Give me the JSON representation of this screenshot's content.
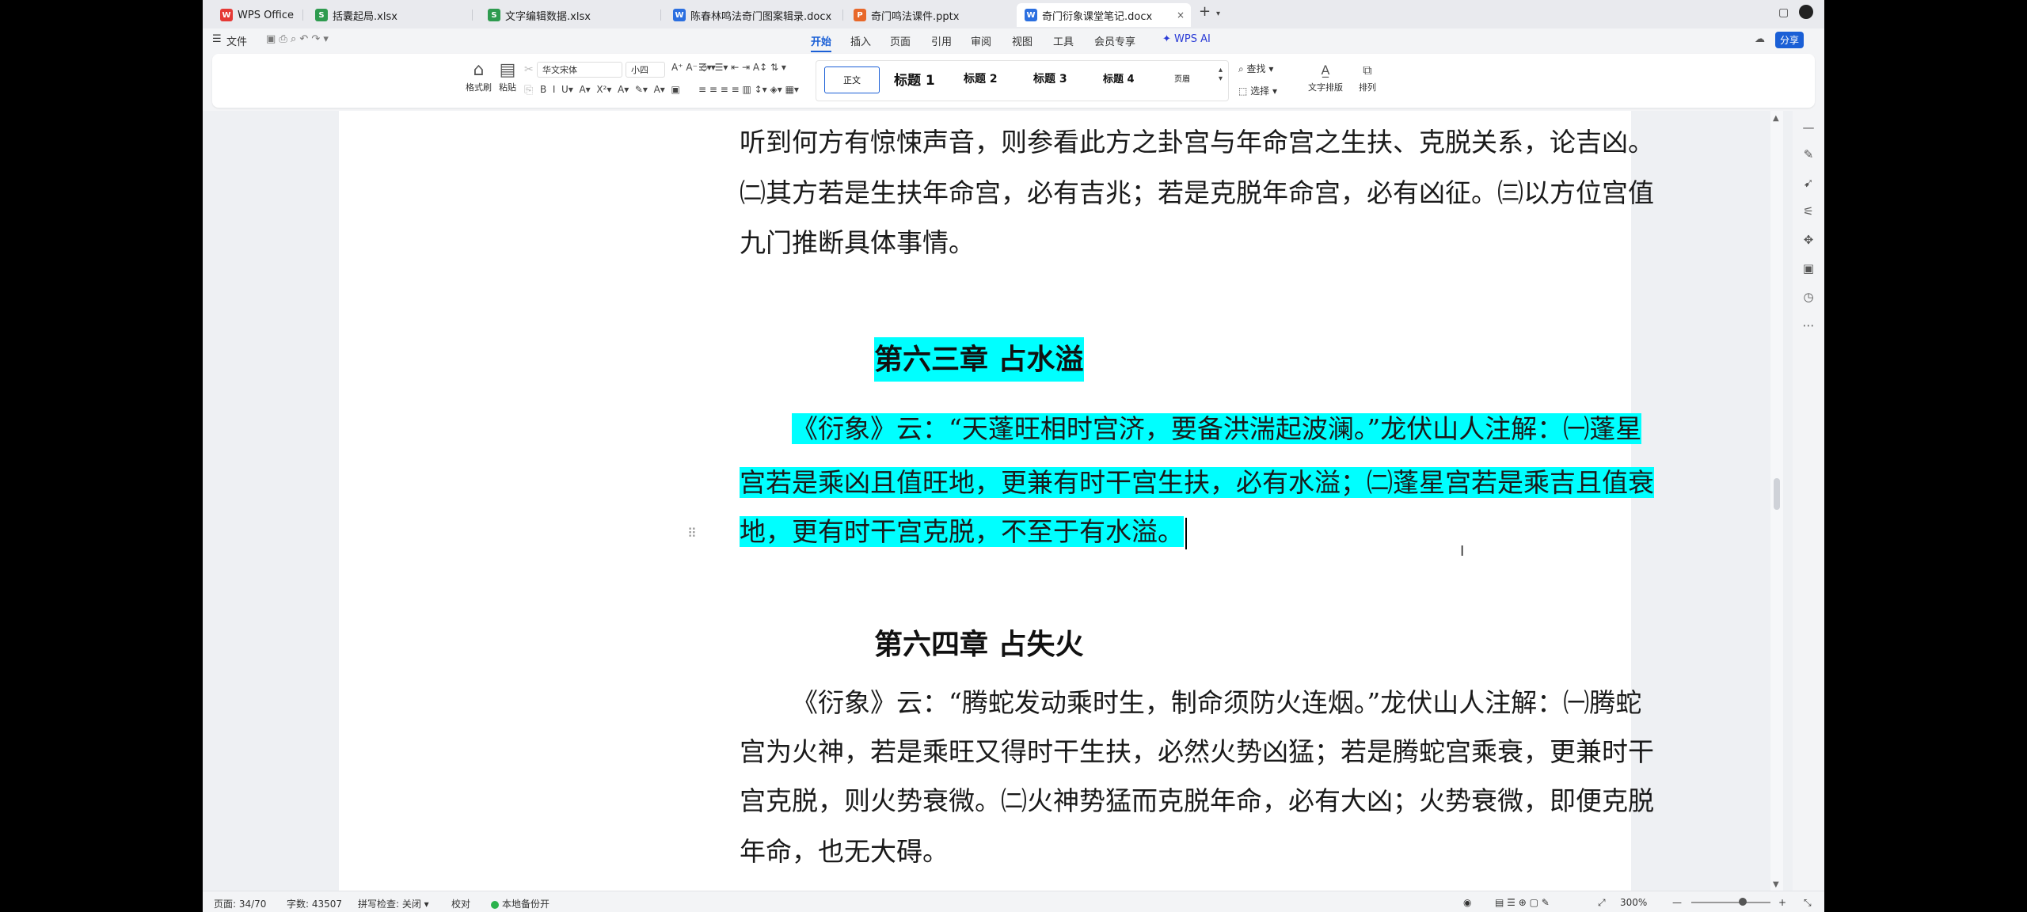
{
  "tabs": [
    {
      "label": "WPS Office",
      "icon": "W",
      "color": "#e53935"
    },
    {
      "label": "括囊起局.xlsx",
      "icon": "S",
      "color": "#2e9b4f"
    },
    {
      "label": "文字编辑数据.xlsx",
      "icon": "S",
      "color": "#2e9b4f"
    },
    {
      "label": "陈春林鸣法奇门图案辑录.docx",
      "icon": "W",
      "color": "#2b6fe0"
    },
    {
      "label": "奇门鸣法课件.pptx",
      "icon": "P",
      "color": "#e8682a"
    },
    {
      "label": "奇门衍象课堂笔记.docx",
      "icon": "W",
      "color": "#2b6fe0",
      "close": "×",
      "add": "+"
    }
  ],
  "menu": {
    "file": "文件",
    "items": [
      "开始",
      "插入",
      "页面",
      "引用",
      "审阅",
      "视图",
      "工具",
      "会员专享"
    ],
    "wps_ai": "WPS AI",
    "share": "分享"
  },
  "ribbon": {
    "format_painter": "格式刷",
    "paste": "粘贴",
    "font_name": "华文宋体",
    "font_size": "小四",
    "styles": [
      "正文",
      "标题 1",
      "标题 2",
      "标题 3",
      "标题 4",
      "页眉"
    ],
    "find": "查找",
    "select": "选择",
    "text_layout": "文字排版",
    "arrange": "排列"
  },
  "document": {
    "lines_top": [
      "听到何方有惊悚声音，则参看此方之卦宫与年命宫之生扶、克脱关系，论吉凶。",
      "㈡其方若是生扶年命宫，必有吉兆；若是克脱年命宫，必有凶征。㈢以方位宫值",
      "九门推断具体事情。"
    ],
    "chapter63_title": "第六三章  占水溢",
    "chapter63_lines": [
      "《衍象》云：“天蓬旺相时宫济，要备洪湍起波澜。”龙伏山人注解：㈠蓬星",
      "宫若是乘凶且值旺地，更兼有时干宫生扶，必有水溢；㈡蓬星宫若是乘吉且值衰",
      "地，更有时干宫克脱，不至于有水溢。"
    ],
    "chapter64_title": "第六四章  占失火",
    "chapter64_lines": [
      "《衍象》云：“腾蛇发动乘时生，制命须防火连烟。”龙伏山人注解：㈠腾蛇",
      "宫为火神，若是乘旺又得时干生扶，必然火势凶猛；若是腾蛇宫乘衰，更兼时干",
      "宫克脱，则火势衰微。㈡火神势猛而克脱年命，必有大凶；火势衰微，即便克脱",
      "年命，也无大碍。"
    ]
  },
  "status": {
    "page": "页面: 34/70",
    "words": "字数: 43507",
    "spell": "拼写检查: 关闭",
    "proof": "校对",
    "backup": "本地备份开",
    "zoom": "300%"
  },
  "colors": {
    "highlight": "#00ffff",
    "accent": "#1a5fd6"
  }
}
